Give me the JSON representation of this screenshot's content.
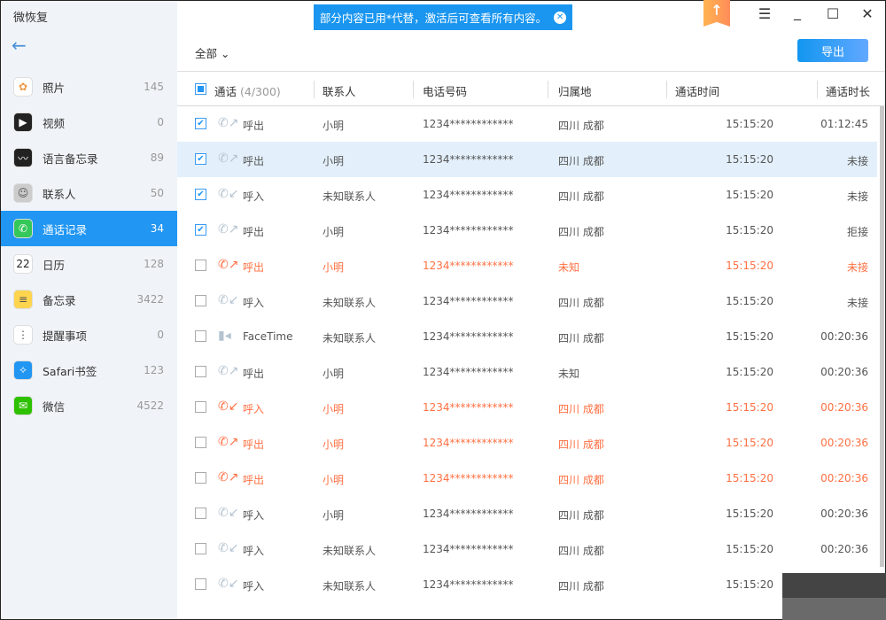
{
  "app": {
    "title": "微恢复"
  },
  "banner": {
    "text": "部分内容已用*代替，激活后可查看所有内容。"
  },
  "sidebar": {
    "items": [
      {
        "label": "照片",
        "count": "145",
        "icon": "photos-icon",
        "color": "#ffffff"
      },
      {
        "label": "视频",
        "count": "0",
        "icon": "video-icon",
        "color": "#222222"
      },
      {
        "label": "语言备忘录",
        "count": "89",
        "icon": "voice-memo-icon",
        "color": "#222222"
      },
      {
        "label": "联系人",
        "count": "50",
        "icon": "contacts-icon",
        "color": "#cccccc"
      },
      {
        "label": "通话记录",
        "count": "34",
        "icon": "phone-icon",
        "color": "#34c759"
      },
      {
        "label": "日历",
        "count": "128",
        "icon": "calendar-icon",
        "color": "#ffffff"
      },
      {
        "label": "备忘录",
        "count": "3422",
        "icon": "notes-icon",
        "color": "#ffd54f"
      },
      {
        "label": "提醒事项",
        "count": "0",
        "icon": "reminders-icon",
        "color": "#ffffff"
      },
      {
        "label": "Safari书签",
        "count": "123",
        "icon": "safari-icon",
        "color": "#2196f3"
      },
      {
        "label": "微信",
        "count": "4522",
        "icon": "wechat-icon",
        "color": "#2dc100"
      }
    ],
    "active": 4,
    "calendar_day": "22"
  },
  "toolbar": {
    "filter": "全部",
    "export": "导出"
  },
  "table": {
    "headers": {
      "call": "通话",
      "count": "(4/300)",
      "contact": "联系人",
      "phone": "电话号码",
      "location": "归属地",
      "time": "通话时间",
      "duration": "通话时长"
    },
    "rows": [
      {
        "checked": true,
        "type": "呼出",
        "contact": "小明",
        "phone": "1234************",
        "location": "四川 成都",
        "time": "15:15:20",
        "duration": "01:12:45",
        "missed": false
      },
      {
        "checked": true,
        "type": "呼出",
        "contact": "小明",
        "phone": "1234************",
        "location": "四川 成都",
        "time": "15:15:20",
        "duration": "未接",
        "missed": false,
        "selected": true
      },
      {
        "checked": true,
        "type": "呼入",
        "contact": "未知联系人",
        "phone": "1234************",
        "location": "四川 成都",
        "time": "15:15:20",
        "duration": "未接",
        "missed": false
      },
      {
        "checked": true,
        "type": "呼出",
        "contact": "小明",
        "phone": "1234************",
        "location": "四川 成都",
        "time": "15:15:20",
        "duration": "拒接",
        "missed": false
      },
      {
        "checked": false,
        "type": "呼出",
        "contact": "小明",
        "phone": "1234************",
        "location": "未知",
        "time": "15:15:20",
        "duration": "未接",
        "missed": true
      },
      {
        "checked": false,
        "type": "呼入",
        "contact": "未知联系人",
        "phone": "1234************",
        "location": "四川 成都",
        "time": "15:15:20",
        "duration": "未接",
        "missed": false
      },
      {
        "checked": false,
        "type": "FaceTime",
        "contact": "未知联系人",
        "phone": "1234************",
        "location": "四川 成都",
        "time": "15:15:20",
        "duration": "00:20:36",
        "missed": false
      },
      {
        "checked": false,
        "type": "呼出",
        "contact": "小明",
        "phone": "1234************",
        "location": "未知",
        "time": "15:15:20",
        "duration": "00:20:36",
        "missed": false
      },
      {
        "checked": false,
        "type": "呼入",
        "contact": "小明",
        "phone": "1234************",
        "location": "四川 成都",
        "time": "15:15:20",
        "duration": "00:20:36",
        "missed": true
      },
      {
        "checked": false,
        "type": "呼出",
        "contact": "小明",
        "phone": "1234************",
        "location": "四川 成都",
        "time": "15:15:20",
        "duration": "00:20:36",
        "missed": true
      },
      {
        "checked": false,
        "type": "呼出",
        "contact": "小明",
        "phone": "1234************",
        "location": "四川 成都",
        "time": "15:15:20",
        "duration": "00:20:36",
        "missed": true
      },
      {
        "checked": false,
        "type": "呼入",
        "contact": "小明",
        "phone": "1234************",
        "location": "四川 成都",
        "time": "15:15:20",
        "duration": "00:20:36",
        "missed": false
      },
      {
        "checked": false,
        "type": "呼入",
        "contact": "未知联系人",
        "phone": "1234************",
        "location": "四川 成都",
        "time": "15:15:20",
        "duration": "00:20:36",
        "missed": false
      },
      {
        "checked": false,
        "type": "呼入",
        "contact": "未知联系人",
        "phone": "1234************",
        "location": "四川 成都",
        "time": "15:15:20",
        "duration": "",
        "missed": false
      }
    ]
  }
}
